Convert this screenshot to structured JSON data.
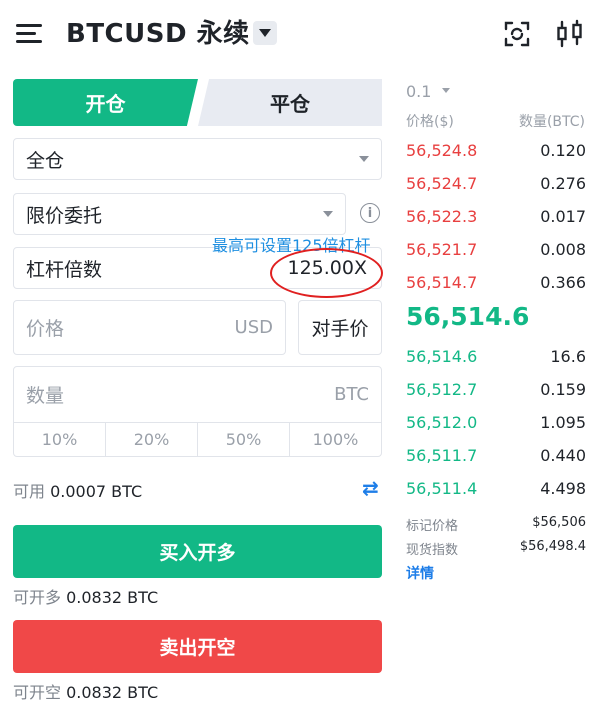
{
  "header": {
    "title": "BTCUSD 永续",
    "icons": [
      "menu-icon",
      "chevron-down-icon",
      "scan-icon",
      "candlestick-icon"
    ]
  },
  "tabs": {
    "open": "开仓",
    "close": "平仓"
  },
  "form": {
    "margin_mode": "全仓",
    "order_type": "限价委托",
    "leverage_label": "杠杆倍数",
    "leverage_value": "125.00X",
    "annotation": "最高可设置125倍杠杆",
    "price_placeholder": "价格",
    "price_unit": "USD",
    "counterparty_price": "对手价",
    "qty_placeholder": "数量",
    "qty_unit": "BTC",
    "percentages": [
      "10%",
      "20%",
      "50%",
      "100%"
    ],
    "available_label": "可用",
    "available_value": "0.0007 BTC"
  },
  "actions": {
    "buy_label": "买入开多",
    "buy_max_label": "可开多",
    "buy_max_value": "0.0832 BTC",
    "sell_label": "卖出开空",
    "sell_max_label": "可开空",
    "sell_max_value": "0.0832 BTC"
  },
  "orderbook": {
    "depth": "0.1",
    "price_header": "价格($)",
    "qty_header": "数量(BTC)",
    "asks": [
      {
        "price": "56,524.8",
        "qty": "0.120"
      },
      {
        "price": "56,524.7",
        "qty": "0.276"
      },
      {
        "price": "56,522.3",
        "qty": "0.017"
      },
      {
        "price": "56,521.7",
        "qty": "0.008"
      },
      {
        "price": "56,514.7",
        "qty": "0.366"
      }
    ],
    "last_price": "56,514.6",
    "bids": [
      {
        "price": "56,514.6",
        "qty": "16.6"
      },
      {
        "price": "56,512.7",
        "qty": "0.159"
      },
      {
        "price": "56,512.0",
        "qty": "1.095"
      },
      {
        "price": "56,511.7",
        "qty": "0.440"
      },
      {
        "price": "56,511.4",
        "qty": "4.498"
      }
    ],
    "mark_price_label": "标记价格",
    "mark_price_value": "$56,506",
    "spot_index_label": "现货指数",
    "spot_index_value": "$56,498.4",
    "details_link": "详情"
  },
  "colors": {
    "green": "#12b886",
    "red": "#f04848",
    "blue": "#1e7ee8",
    "annotation": "#e02020"
  }
}
